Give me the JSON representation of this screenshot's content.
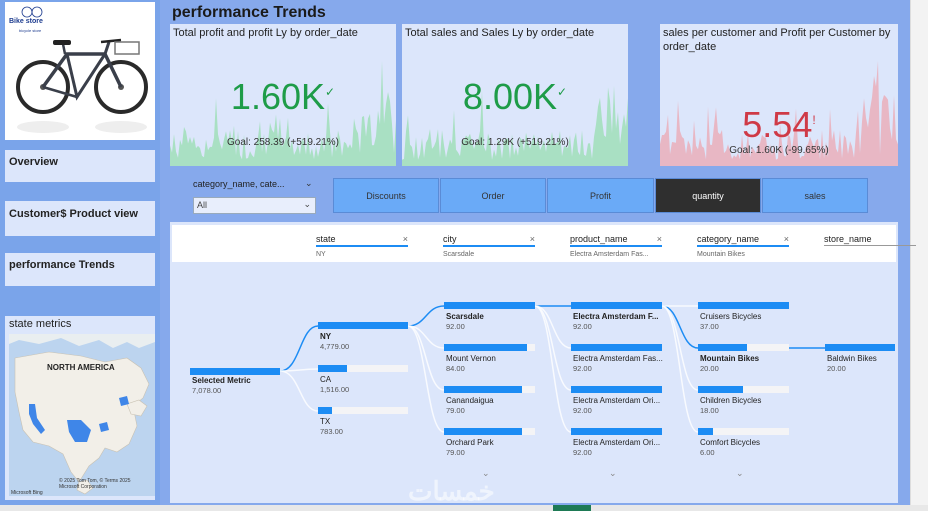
{
  "sidebar": {
    "logo_text": "Bike store",
    "logo_sub": "bicycle store",
    "nav": [
      {
        "label": "Overview"
      },
      {
        "label": "Customer$ Product view"
      },
      {
        "label": "performance Trends"
      }
    ],
    "map_card": {
      "title": "state metrics",
      "region_label": "NORTH AMERICA",
      "credit": "© 2025 Tom Tom, © Terms 2025 Microsoft Corporation",
      "brand": "Microsoft Bing"
    }
  },
  "page": {
    "title": "performance Trends"
  },
  "kpis": [
    {
      "title": "Total profit and profit Ly by order_date",
      "value": "1.60K",
      "status_glyph": "✓",
      "goal": "Goal: 258.39 (+519.21%)",
      "color": "#1e9c48"
    },
    {
      "title": "Total sales and Sales Ly by order_date",
      "value": "8.00K",
      "status_glyph": "✓",
      "goal": "Goal: 1.29K (+519.21%)",
      "color": "#1e9c48"
    },
    {
      "title": "sales per customer and Profit per Customer by order_date",
      "value": "5.54",
      "status_glyph": "!",
      "goal": "Goal: 1.60K (-99.65%)",
      "color": "#cf3a47"
    }
  ],
  "slicer": {
    "label": "category_name, cate...",
    "value": "All"
  },
  "tabs": [
    {
      "label": "Discounts"
    },
    {
      "label": "Order"
    },
    {
      "label": "Profit"
    },
    {
      "label": "quantity",
      "active": true
    },
    {
      "label": "sales"
    }
  ],
  "tree": {
    "columns": [
      {
        "name": "state",
        "value": "NY"
      },
      {
        "name": "city",
        "value": "Scarsdale"
      },
      {
        "name": "product_name",
        "value": "Electra Amsterdam Fas..."
      },
      {
        "name": "category_name",
        "value": "Mountain Bikes"
      },
      {
        "name": "store_name",
        "value": ""
      }
    ],
    "root": {
      "label": "Selected Metric",
      "value": "7,078.00"
    },
    "state_nodes": [
      {
        "label": "NY",
        "value": "4,779.00",
        "fill": 1.0,
        "selected": true
      },
      {
        "label": "CA",
        "value": "1,516.00",
        "fill": 0.32
      },
      {
        "label": "TX",
        "value": "783.00",
        "fill": 0.16
      }
    ],
    "city_nodes": [
      {
        "label": "Scarsdale",
        "value": "92.00",
        "fill": 1.0,
        "selected": true
      },
      {
        "label": "Mount Vernon",
        "value": "84.00",
        "fill": 0.91
      },
      {
        "label": "Canandaigua",
        "value": "79.00",
        "fill": 0.86
      },
      {
        "label": "Orchard Park",
        "value": "79.00",
        "fill": 0.86
      }
    ],
    "product_nodes": [
      {
        "label": "Electra Amsterdam F...",
        "value": "92.00",
        "fill": 1.0,
        "selected": true
      },
      {
        "label": "Electra Amsterdam Fas...",
        "value": "92.00",
        "fill": 1.0
      },
      {
        "label": "Electra Amsterdam Ori...",
        "value": "92.00",
        "fill": 1.0
      },
      {
        "label": "Electra Amsterdam Ori...",
        "value": "92.00",
        "fill": 1.0
      }
    ],
    "category_nodes": [
      {
        "label": "Cruisers Bicycles",
        "value": "37.00",
        "fill": 1.0
      },
      {
        "label": "Mountain Bikes",
        "value": "20.00",
        "fill": 0.54,
        "selected": true
      },
      {
        "label": "Children Bicycles",
        "value": "18.00",
        "fill": 0.49
      },
      {
        "label": "Comfort Bicycles",
        "value": "6.00",
        "fill": 0.16
      }
    ],
    "store_nodes": [
      {
        "label": "Baldwin Bikes",
        "value": "20.00",
        "fill": 1.0
      }
    ]
  },
  "watermark": "خمسات"
}
